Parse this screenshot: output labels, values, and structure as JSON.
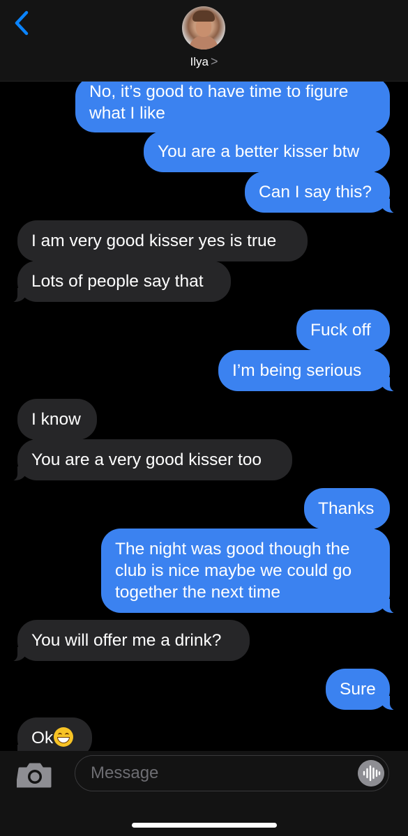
{
  "header": {
    "contact_name": "Ilya",
    "chevron": ">"
  },
  "messages": [
    {
      "from": "me",
      "text": "No, it’s good to have time to figure what I like"
    },
    {
      "from": "me",
      "text": "You are a better kisser btw"
    },
    {
      "from": "me",
      "text": "Can I say this?"
    },
    {
      "from": "them",
      "text": "I am very good kisser yes is true"
    },
    {
      "from": "them",
      "text": "Lots of people say that"
    },
    {
      "from": "me",
      "text": "Fuck off"
    },
    {
      "from": "me",
      "text": "I’m being serious"
    },
    {
      "from": "them",
      "text": "I know"
    },
    {
      "from": "them",
      "text": "You are a very good kisser too"
    },
    {
      "from": "me",
      "text": "Thanks"
    },
    {
      "from": "me",
      "text": "The night was good though the club is nice maybe we could go together the next time"
    },
    {
      "from": "them",
      "text": "You will offer me a drink?"
    },
    {
      "from": "me",
      "text": "Sure"
    },
    {
      "from": "them",
      "text": "Ok",
      "emoji": "grinning-face-with-smiling-eyes"
    }
  ],
  "composer": {
    "placeholder": "Message"
  },
  "colors": {
    "sent": "#3b82f0",
    "received": "#262628",
    "accent": "#0a84ff"
  },
  "icons": [
    "back-chevron-icon",
    "camera-icon",
    "voice-waveform-icon"
  ]
}
